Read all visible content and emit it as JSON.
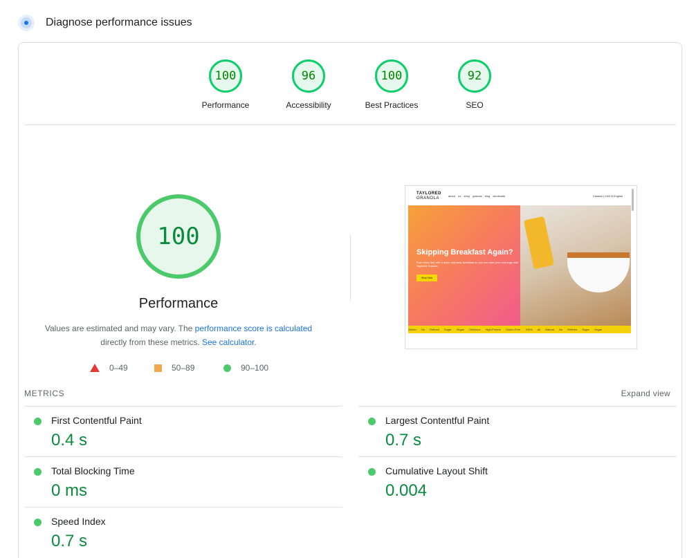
{
  "header": {
    "title": "Diagnose performance issues",
    "icon": "performance-gauge-icon"
  },
  "categories": [
    {
      "score": "100",
      "label": "Performance"
    },
    {
      "score": "96",
      "label": "Accessibility"
    },
    {
      "score": "100",
      "label": "Best Practices"
    },
    {
      "score": "92",
      "label": "SEO"
    }
  ],
  "main_gauge": {
    "score": "100",
    "title": "Performance"
  },
  "description": {
    "before_link": "Values are estimated and may vary. The ",
    "link1": "performance score is calculated",
    "middle": " directly from these metrics. ",
    "link2": "See calculator",
    "after": "."
  },
  "legend": [
    {
      "range": "0–49",
      "shape": "triangle",
      "color": "#e53935"
    },
    {
      "range": "50–89",
      "shape": "square",
      "color": "#f0a94f"
    },
    {
      "range": "90–100",
      "shape": "circle",
      "color": "#4cc96a"
    }
  ],
  "screenshot": {
    "brand_line1": "TAYLORED",
    "brand_line2": "GRANOLA",
    "nav_links": "about us shop granola blog wholesale",
    "nav_right": "Canada | CAD $ English",
    "hero_title": "Skipping Breakfast Again?",
    "hero_sub": "Fuel every day with a quick and tasty breakfast so you can start your mornings with Taylored Granola",
    "hero_button": "Shop Now",
    "ticker": "Gluten No Refined Sugar Vegan Delicious High-Protein Gluten-Free 100% All Natural No Refined Sugar Vegan"
  },
  "metrics": {
    "heading": "METRICS",
    "expand_label": "Expand view",
    "items": [
      {
        "label": "First Contentful Paint",
        "value": "0.4 s"
      },
      {
        "label": "Largest Contentful Paint",
        "value": "0.7 s"
      },
      {
        "label": "Total Blocking Time",
        "value": "0 ms"
      },
      {
        "label": "Cumulative Layout Shift",
        "value": "0.004"
      },
      {
        "label": "Speed Index",
        "value": "0.7 s"
      }
    ]
  },
  "colors": {
    "pass_green": "#0cce6b",
    "value_green": "#0a8a3e",
    "link_blue": "#1a73e8"
  }
}
